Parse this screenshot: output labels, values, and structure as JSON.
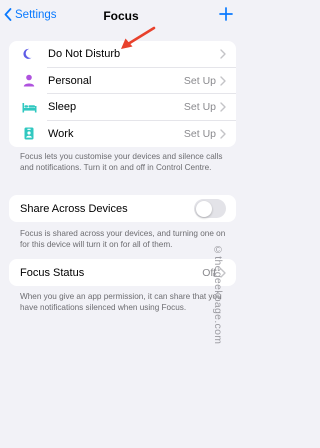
{
  "navbar": {
    "back_label": "Settings",
    "title": "Focus",
    "add_icon": "plus-icon"
  },
  "focus_modes": [
    {
      "label": "Do Not Disturb",
      "value": "",
      "icon": "moon-icon",
      "icon_color": "#5e5ce6"
    },
    {
      "label": "Personal",
      "value": "Set Up",
      "icon": "person-icon",
      "icon_color": "#af52de"
    },
    {
      "label": "Sleep",
      "value": "Set Up",
      "icon": "bed-icon",
      "icon_color": "#30c8c0"
    },
    {
      "label": "Work",
      "value": "Set Up",
      "icon": "id-badge-icon",
      "icon_color": "#30c8c0"
    }
  ],
  "focus_footer": "Focus lets you customise your devices and silence calls and notifications. Turn it on and off in Control Centre.",
  "share": {
    "label": "Share Across Devices",
    "enabled": false,
    "footer": "Focus is shared across your devices, and turning one on for this device will turn it on for all of them."
  },
  "status": {
    "label": "Focus Status",
    "value": "Off",
    "footer": "When you give an app permission, it can share that you have notifications silenced when using Focus."
  },
  "watermark": "©thegeekpage.com",
  "colors": {
    "accent": "#0a7aff",
    "annotation_arrow": "#e8412c"
  }
}
